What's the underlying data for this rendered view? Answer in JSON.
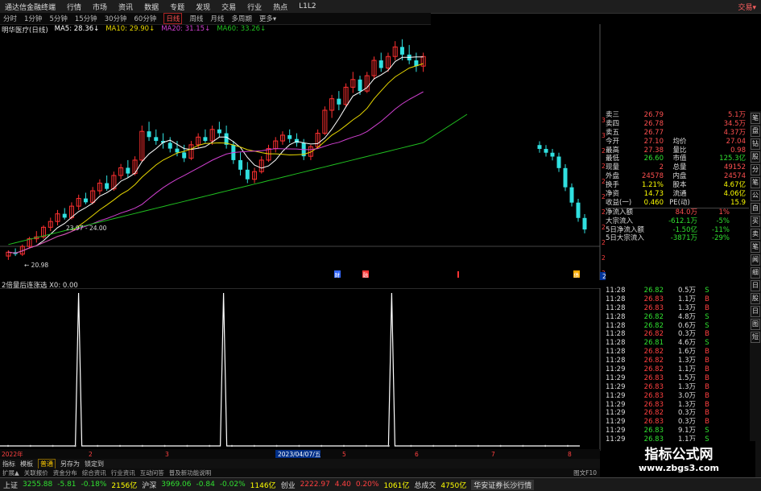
{
  "top_menu": [
    "通达信金融终端",
    "行情",
    "市场",
    "资讯",
    "数据",
    "专题",
    "发现",
    "交易",
    "行业",
    "热点",
    "L1L2",
    "交易▾"
  ],
  "timeframes": [
    {
      "label": "分时",
      "sel": false
    },
    {
      "label": "1分钟",
      "sel": false
    },
    {
      "label": "5分钟",
      "sel": false
    },
    {
      "label": "15分钟",
      "sel": false
    },
    {
      "label": "30分钟",
      "sel": false
    },
    {
      "label": "60分钟",
      "sel": false
    },
    {
      "label": "日线",
      "sel": true
    },
    {
      "label": "周线",
      "sel": false
    },
    {
      "label": "月线",
      "sel": false
    },
    {
      "label": "多周期",
      "sel": false
    },
    {
      "label": "更多▾",
      "sel": false
    }
  ],
  "legend": {
    "name": "明华医疗(日线)",
    "ma5": "MA5: 28.36↓",
    "ma10": "MA10: 29.90↓",
    "ma20": "MA20: 31.15↓",
    "ma60": "MA60: 33.26↓"
  },
  "colors": {
    "ma5": "#ffffff",
    "ma10": "#e8d800",
    "ma20": "#d040d0",
    "ma60": "#20c020",
    "up": "#ff3030",
    "down": "#30e0e0"
  },
  "price_axis": [
    "31.00",
    "30.00",
    "29.00",
    "28.00",
    "27.00",
    "26.00",
    "25.00",
    "24.00",
    "23.00",
    "22.00",
    "21.17"
  ],
  "sub_axis": [
    "1.00",
    "0.90",
    "0.80",
    "0.70",
    "0.60",
    "0.50",
    "0.40",
    "0.30",
    "0.20",
    "0.10",
    "0.00"
  ],
  "chart_labels": {
    "hi": "24.00",
    "lo": "20.98",
    "range": "23.97 - 24.00",
    "marker1": "财",
    "marker2": "融",
    "marker3": "债"
  },
  "sub_legend": "2倍量后连涨选 X0: 0.00",
  "x_labels": [
    "2022年",
    "2",
    "3",
    "2023/04/07/五",
    "5",
    "6",
    "7",
    "8"
  ],
  "quote_rows": [
    {
      "k": "卖三",
      "v1": "26.79",
      "k2": "",
      "v2": "5.1万",
      "c": "#ff5050"
    },
    {
      "k": "卖四",
      "v1": "26.78",
      "k2": "",
      "v2": "34.5万",
      "c": "#ff5050"
    },
    {
      "k": "卖五",
      "v1": "26.77",
      "k2": "",
      "v2": "4.37万",
      "c": "#ff5050"
    },
    {
      "k": "今开",
      "v1": "27.10",
      "k2": "均价",
      "v2": "27.04",
      "c": "#ff5050"
    },
    {
      "k": "最高",
      "v1": "27.38",
      "k2": "量比",
      "v2": "0.98",
      "c": "#ff5050"
    },
    {
      "k": "最低",
      "v1": "26.60",
      "k2": "市值",
      "v2": "125.3亿",
      "c": "#30e030"
    },
    {
      "k": "现量",
      "v1": "2",
      "k2": "总量",
      "v2": "49152",
      "c": "#ff5050"
    },
    {
      "k": "外盘",
      "v1": "24578",
      "k2": "内盘",
      "v2": "24574",
      "c": "#ff5050"
    },
    {
      "k": "换手",
      "v1": "1.21%",
      "k2": "股本",
      "v2": "4.67亿",
      "c": "#ffff00"
    },
    {
      "k": "净资",
      "v1": "14.73",
      "k2": "流通",
      "v2": "4.06亿",
      "c": "#ffff00"
    },
    {
      "k": "收益(一)",
      "v1": "0.460",
      "k2": "PE(动)",
      "v2": "15.9",
      "c": "#ffff00"
    },
    {
      "k": "净流入额",
      "v1": "84.0万",
      "k2": "",
      "v2": "1%",
      "c": "#ff5050"
    },
    {
      "k": "大宗流入",
      "v1": "-612.1万",
      "k2": "",
      "v2": "-5%",
      "c": "#30e030"
    },
    {
      "k": "5日净流入额",
      "v1": "-1.50亿",
      "k2": "",
      "v2": "-11%",
      "c": "#30e030"
    },
    {
      "k": "5日大宗流入",
      "v1": "-3871万",
      "k2": "",
      "v2": "-29%",
      "c": "#30e030"
    }
  ],
  "ticks": [
    {
      "t": "11:28",
      "p": "26.82",
      "q": "0.5万",
      "d": "S"
    },
    {
      "t": "11:28",
      "p": "26.83",
      "q": "1.1万",
      "d": "B"
    },
    {
      "t": "11:28",
      "p": "26.83",
      "q": "1.3万",
      "d": "B"
    },
    {
      "t": "11:28",
      "p": "26.82",
      "q": "4.8万",
      "d": "S"
    },
    {
      "t": "11:28",
      "p": "26.82",
      "q": "0.6万",
      "d": "S"
    },
    {
      "t": "11:28",
      "p": "26.82",
      "q": "0.3万",
      "d": "B"
    },
    {
      "t": "11:28",
      "p": "26.81",
      "q": "4.6万",
      "d": "S"
    },
    {
      "t": "11:28",
      "p": "26.82",
      "q": "1.6万",
      "d": "B"
    },
    {
      "t": "11:28",
      "p": "26.82",
      "q": "1.3万",
      "d": "B"
    },
    {
      "t": "11:29",
      "p": "26.82",
      "q": "1.1万",
      "d": "B"
    },
    {
      "t": "11:29",
      "p": "26.83",
      "q": "1.5万",
      "d": "B"
    },
    {
      "t": "11:29",
      "p": "26.83",
      "q": "1.3万",
      "d": "B"
    },
    {
      "t": "11:29",
      "p": "26.83",
      "q": "3.0万",
      "d": "B"
    },
    {
      "t": "11:29",
      "p": "26.83",
      "q": "1.3万",
      "d": "B"
    },
    {
      "t": "11:29",
      "p": "26.82",
      "q": "0.3万",
      "d": "B"
    },
    {
      "t": "11:29",
      "p": "26.83",
      "q": "0.3万",
      "d": "B"
    },
    {
      "t": "11:29",
      "p": "26.83",
      "q": "9.1万",
      "d": "S"
    },
    {
      "t": "11:29",
      "p": "26.83",
      "q": "1.1万",
      "d": "S"
    },
    {
      "t": "11:29",
      "p": "26.83",
      "q": "3.0万",
      "d": "B"
    },
    {
      "t": "11:29",
      "p": "26.83",
      "q": "1.1万",
      "d": "B"
    }
  ],
  "right_tabs": [
    "笔",
    "盘",
    "钻",
    "股",
    "分",
    "笔",
    "公",
    "自",
    "买",
    "卖",
    "笔",
    "闻",
    "细",
    "日",
    "股",
    "日",
    "图",
    "短"
  ],
  "bottom_tabs": [
    {
      "label": "指标",
      "sel": false
    },
    {
      "label": "模板",
      "sel": false
    },
    {
      "label": "普通",
      "sel": true
    },
    {
      "label": "另存为",
      "sel": false
    },
    {
      "label": "锁定到",
      "sel": false
    }
  ],
  "bottom_tabs2": [
    "扩展▲",
    "关联报价",
    "资金分布",
    "综合资讯",
    "行业资讯",
    "互动问答",
    "普及新功能说明",
    "图文F10"
  ],
  "status": [
    {
      "label": "上证",
      "val": "3255.88",
      "chg": "-5.81",
      "pct": "-0.18%",
      "amt": "2156亿"
    },
    {
      "label": "沪深",
      "val": "3969.06",
      "chg": "-0.84",
      "pct": "-0.02%",
      "amt": "1146亿"
    },
    {
      "label": "创业",
      "val": "2222.97",
      "chg": "4.40",
      "pct": "0.20%",
      "amt": "1061亿"
    },
    {
      "label": "总成交",
      "val": "4750亿",
      "chg": "",
      "pct": "",
      "amt": ""
    }
  ],
  "broker": "华安证券长沙行情",
  "watermark": {
    "line1": "指标公式网",
    "line2": "www.zbgs3.com"
  },
  "chart_data": {
    "type": "candlestick",
    "y_range": [
      20.5,
      32.5
    ],
    "candles": [
      [
        21.0,
        21.3,
        20.8,
        21.2
      ],
      [
        21.2,
        21.4,
        21.0,
        21.1
      ],
      [
        21.1,
        21.6,
        21.0,
        21.5
      ],
      [
        21.5,
        22.0,
        21.4,
        21.9
      ],
      [
        21.9,
        22.3,
        21.7,
        22.0
      ],
      [
        22.0,
        22.6,
        21.9,
        22.5
      ],
      [
        22.5,
        23.0,
        22.3,
        22.8
      ],
      [
        22.8,
        23.4,
        22.6,
        23.2
      ],
      [
        23.2,
        23.5,
        22.9,
        23.0
      ],
      [
        23.0,
        23.8,
        22.9,
        23.6
      ],
      [
        23.6,
        24.2,
        23.4,
        24.0
      ],
      [
        24.0,
        24.3,
        23.7,
        23.8
      ],
      [
        23.8,
        24.6,
        23.7,
        24.4
      ],
      [
        24.4,
        25.0,
        24.2,
        24.8
      ],
      [
        24.8,
        25.2,
        24.4,
        24.5
      ],
      [
        24.5,
        25.4,
        24.4,
        25.2
      ],
      [
        25.2,
        25.8,
        25.0,
        25.6
      ],
      [
        25.6,
        26.0,
        25.1,
        25.3
      ],
      [
        25.3,
        26.2,
        25.2,
        26.0
      ],
      [
        26.0,
        27.8,
        25.9,
        27.5
      ],
      [
        27.5,
        28.0,
        27.0,
        27.2
      ],
      [
        27.2,
        27.6,
        26.8,
        27.0
      ],
      [
        27.0,
        27.4,
        26.6,
        26.9
      ],
      [
        26.9,
        27.2,
        26.4,
        26.6
      ],
      [
        26.6,
        27.0,
        26.2,
        26.4
      ],
      [
        26.4,
        26.8,
        25.9,
        26.1
      ],
      [
        26.1,
        27.0,
        26.0,
        26.8
      ],
      [
        26.8,
        27.4,
        26.6,
        27.2
      ],
      [
        27.2,
        27.6,
        26.9,
        27.0
      ],
      [
        27.0,
        27.8,
        26.8,
        27.6
      ],
      [
        27.6,
        28.0,
        27.2,
        27.4
      ],
      [
        27.4,
        27.8,
        26.6,
        26.8
      ],
      [
        26.8,
        27.0,
        25.8,
        26.0
      ],
      [
        26.0,
        26.4,
        25.2,
        25.5
      ],
      [
        25.5,
        25.9,
        24.8,
        25.0
      ],
      [
        25.0,
        25.6,
        24.8,
        25.4
      ],
      [
        25.4,
        26.2,
        25.3,
        26.0
      ],
      [
        26.0,
        26.8,
        25.9,
        26.6
      ],
      [
        26.6,
        27.2,
        26.4,
        27.0
      ],
      [
        27.0,
        27.5,
        26.8,
        27.3
      ],
      [
        27.3,
        27.6,
        26.9,
        27.1
      ],
      [
        27.1,
        27.4,
        26.7,
        26.9
      ],
      [
        26.9,
        27.1,
        26.0,
        26.2
      ],
      [
        26.2,
        26.8,
        26.0,
        26.7
      ],
      [
        26.7,
        27.6,
        26.6,
        27.4
      ],
      [
        27.4,
        28.8,
        27.3,
        28.6
      ],
      [
        28.6,
        29.4,
        28.2,
        29.2
      ],
      [
        29.2,
        29.6,
        28.6,
        28.9
      ],
      [
        28.9,
        30.0,
        28.8,
        29.8
      ],
      [
        29.8,
        30.6,
        29.5,
        30.2
      ],
      [
        30.2,
        30.4,
        29.4,
        29.6
      ],
      [
        29.6,
        30.6,
        29.5,
        30.4
      ],
      [
        30.4,
        31.4,
        30.2,
        31.2
      ],
      [
        31.2,
        31.6,
        30.6,
        30.8
      ],
      [
        30.8,
        31.6,
        30.6,
        31.4
      ],
      [
        31.4,
        32.2,
        31.2,
        31.9
      ],
      [
        31.9,
        32.3,
        31.2,
        31.5
      ],
      [
        31.5,
        32.0,
        31.0,
        31.2
      ],
      [
        31.2,
        31.6,
        30.6,
        30.9
      ],
      [
        30.9,
        31.6,
        30.6,
        31.4
      ]
    ],
    "candles_right": [
      [
        31.4,
        31.6,
        31.0,
        31.2
      ],
      [
        31.2,
        31.4,
        30.8,
        31.0
      ],
      [
        31.0,
        31.2,
        30.6,
        30.8
      ],
      [
        30.8,
        31.0,
        30.0,
        30.2
      ],
      [
        30.2,
        30.4,
        29.0,
        29.2
      ],
      [
        29.2,
        29.4,
        28.2,
        28.4
      ],
      [
        28.4,
        28.6,
        27.4,
        27.6
      ],
      [
        27.6,
        27.8,
        26.8,
        27.0
      ]
    ],
    "spike_positions": [
      0.08,
      0.33,
      0.62
    ]
  }
}
